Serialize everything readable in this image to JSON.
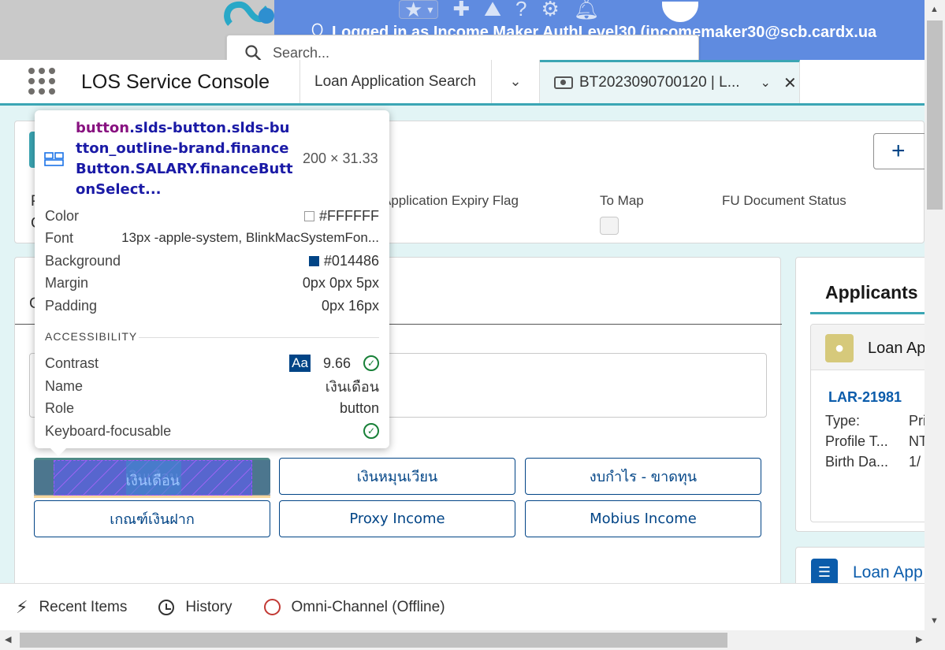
{
  "browser": {
    "logged_in_text": "Logged in as Income Maker AuthLevel30 (incomemaker30@scb.cardx.ua",
    "search_placeholder": "Search..."
  },
  "nav": {
    "app_name": "LOS Service Console",
    "tabs": [
      {
        "label": "Loan Application Search"
      },
      {
        "label": "BT2023090700120 | L..."
      }
    ]
  },
  "highlights": {
    "fields": [
      "Application Expiry Flag",
      "To Map",
      "FU Document Status"
    ],
    "stub_p": "P",
    "stub_c": "C"
  },
  "main": {
    "stub_c": "C",
    "finance_buttons": [
      {
        "label": "เงินเดือน",
        "selected": true
      },
      {
        "label": "เงินหมุนเวียน"
      },
      {
        "label": "งบกำไร - ขาดทุน"
      },
      {
        "label": "เกณฑ์เงินฝาก"
      },
      {
        "label": "Proxy Income"
      },
      {
        "label": "Mobius Income"
      }
    ]
  },
  "right": {
    "applicants_title": "Applicants",
    "loan_app_label": "Loan Ap",
    "lar_id": "LAR-21981",
    "rows": [
      {
        "k": "Type:",
        "v": "Pri"
      },
      {
        "k": "Profile T...",
        "v": "NT"
      },
      {
        "k": "Birth Da...",
        "v": "1/"
      }
    ],
    "loan_app2": "Loan App"
  },
  "utility": {
    "recent": "Recent Items",
    "history": "History",
    "omni": "Omni-Channel (Offline)"
  },
  "tooltip": {
    "tag": "button",
    "selector": ".slds-button.slds-button_outline-brand.financeButton.SALARY.financeButtonSelect...",
    "dims": "200 × 31.33",
    "color_label": "Color",
    "color_value": "#FFFFFF",
    "font_label": "Font",
    "font_value": "13px -apple-system, BlinkMacSystemFon...",
    "background_label": "Background",
    "background_value": "#014486",
    "margin_label": "Margin",
    "margin_value": "0px 0px 5px",
    "padding_label": "Padding",
    "padding_value": "0px 16px",
    "accessibility_title": "ACCESSIBILITY",
    "contrast_label": "Contrast",
    "contrast_aa": "Aa",
    "contrast_value": "9.66",
    "name_label": "Name",
    "name_value": "เงินเดือน",
    "role_label": "Role",
    "role_value": "button",
    "keyboard_label": "Keyboard-focusable",
    "colors": {
      "swatch_color": "#FFFFFF",
      "swatch_bg": "#014486"
    }
  }
}
